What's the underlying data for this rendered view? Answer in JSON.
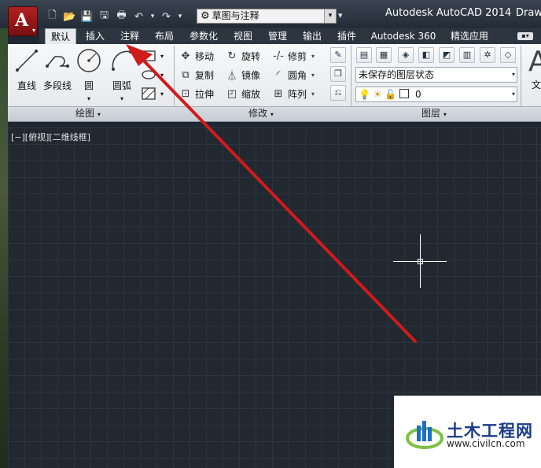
{
  "app": {
    "title": "Autodesk AutoCAD 2014",
    "doc_title": "Draw",
    "menu_glyph": "A",
    "menu_caret": "▾"
  },
  "quick_access": {
    "workspace": "草图与注释",
    "dropdown_glyph": "▾",
    "icons": [
      "new-file-icon",
      "open-folder-icon",
      "save-icon",
      "save-as-icon",
      "print-icon",
      "undo-icon",
      "undo-dropdown-icon",
      "redo-icon",
      "redo-dropdown-icon"
    ],
    "glyphs": [
      "🗋",
      "📂",
      "💾",
      "🖫",
      "🖶",
      "↶",
      "▾",
      "↷",
      "▾"
    ]
  },
  "tabs": [
    "默认",
    "插入",
    "注释",
    "布局",
    "参数化",
    "视图",
    "管理",
    "输出",
    "插件",
    "Autodesk 360",
    "精选应用"
  ],
  "tab_extra": "▪▾",
  "active_tab": 0,
  "ribbon": {
    "draw": {
      "title": "绘图",
      "line": "直线",
      "polyline": "多段线",
      "circle": "圆",
      "arc": "圆弧",
      "caret": "▾"
    },
    "modify": {
      "title": "修改",
      "move": "移动",
      "rotate": "旋转",
      "trim": "修剪",
      "copy": "复制",
      "mirror": "镜像",
      "fillet": "圆角",
      "stretch": "拉伸",
      "scale": "缩放",
      "array": "阵列",
      "caret": "▾"
    },
    "layers": {
      "title": "图层",
      "layer_state": "未保存的图层状态",
      "current_layer": "0",
      "caret": "▾"
    },
    "annotation_partial": {
      "big_letter": "A",
      "label": "文"
    }
  },
  "viewport": {
    "label": "[−][俯视][二维线框]"
  },
  "watermark": {
    "name": "土木工程网",
    "url": "www.civilcn.com"
  },
  "colors": {
    "canvas": "#212830",
    "arrow": "#d11a1a",
    "app_button": "#b02020",
    "watermark_text": "#1a3a8a"
  }
}
